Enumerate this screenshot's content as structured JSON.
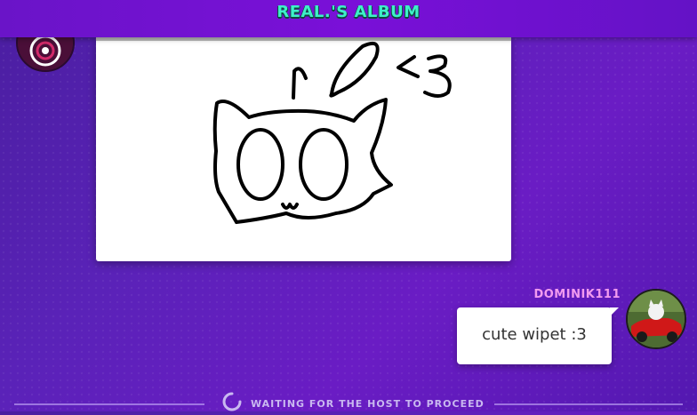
{
  "header": {
    "title": "REAL.'S ALBUM"
  },
  "message": {
    "username": "DOMINIK111",
    "text": "cute wipet :3"
  },
  "footer": {
    "status": "WAITING FOR THE HOST TO PROCEED"
  },
  "icons": {
    "spinner": "loading-spinner-icon"
  },
  "colors": {
    "title": "#3df0c8",
    "username": "#f29bf0",
    "accent": "#7a10d8"
  }
}
